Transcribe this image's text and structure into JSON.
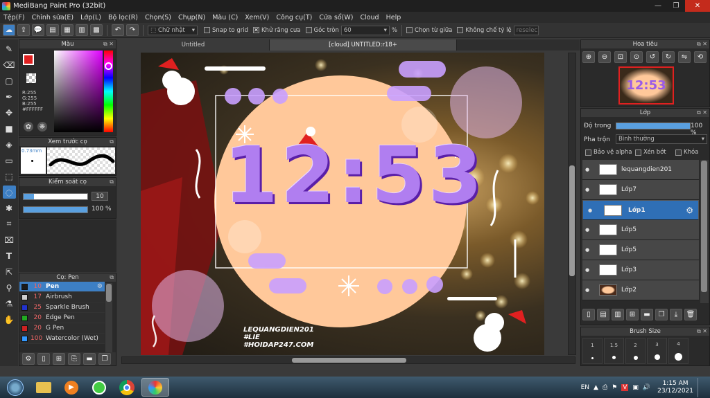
{
  "window": {
    "title": "MediBang Paint Pro (32bit)"
  },
  "menu": [
    "Tệp(F)",
    "Chỉnh sửa(E)",
    "Lớp(L)",
    "Bộ lọc(R)",
    "Chọn(S)",
    "Chụp(N)",
    "Màu (C)",
    "Xem(V)",
    "Công cụ(T)",
    "Cửa sổ(W)",
    "Cloud",
    "Help"
  ],
  "toolbar": {
    "shape": "Chữ nhật",
    "snap_to_grid": "Snap to grid",
    "antialias": "Khử răng cưa",
    "round_corner": "Góc tròn",
    "round_value": "60",
    "percent": "%",
    "center_select": "Chọn từ giữa",
    "keep_ratio": "Không chế tỷ lệ",
    "reselect": "reselec"
  },
  "color_panel": {
    "title": "Màu",
    "r": "R:255",
    "g": "G:255",
    "b": "B:255",
    "hex": "#FFFFFF",
    "fg": "#e02020",
    "bg": "#ffffff"
  },
  "brush_preview": {
    "title": "Xem trước cọ",
    "size": "0.73mm"
  },
  "brush_control": {
    "title": "Kiểm soát cọ",
    "size_value": "10",
    "opacity_value": "100 %"
  },
  "brush_list": {
    "title": "Cọ: Pen",
    "items": [
      {
        "num": "10",
        "name": "Pen",
        "color": "#1a1a1a",
        "selected": true
      },
      {
        "num": "17",
        "name": "Airbrush",
        "color": "#cfcfcf",
        "selected": false
      },
      {
        "num": "25",
        "name": "Sparkle Brush",
        "color": "#2233cc",
        "selected": false
      },
      {
        "num": "20",
        "name": "Edge Pen",
        "color": "#22aa22",
        "selected": false
      },
      {
        "num": "20",
        "name": "G Pen",
        "color": "#cc2222",
        "selected": false
      },
      {
        "num": "100",
        "name": "Watercolor (Wet)",
        "color": "#3399ff",
        "selected": false
      }
    ]
  },
  "tabs": [
    {
      "label": "Untitled",
      "active": false
    },
    {
      "label": "[cloud] UNTITLED:r18+",
      "active": true
    }
  ],
  "artwork": {
    "time": "12:53",
    "watermark": [
      "LEQUANGDIEN201",
      "#LIE",
      "#HOIDAP247.COM"
    ]
  },
  "navigator": {
    "title": "Hoa tiêu",
    "thumb_text": "12:53"
  },
  "layers_panel": {
    "title": "Lớp",
    "opacity_label": "Độ trong",
    "opacity_value": "100 %",
    "blend_label": "Pha trộn",
    "blend_value": "Bình thường",
    "protect_alpha": "Bảo vệ alpha",
    "clipping": "Xén bớt",
    "lock": "Khóa",
    "layers": [
      {
        "name": "lequangdien201",
        "selected": false
      },
      {
        "name": "Lớp7",
        "selected": false
      },
      {
        "name": "Lớp1",
        "selected": true
      },
      {
        "name": "Lớp5",
        "selected": false
      },
      {
        "name": "Lớp5",
        "selected": false
      },
      {
        "name": "Lớp3",
        "selected": false
      },
      {
        "name": "Lớp2",
        "selected": false
      }
    ]
  },
  "brush_size": {
    "title": "Brush Size",
    "sizes": [
      "1",
      "1.5",
      "2",
      "3",
      "4"
    ]
  },
  "taskbar": {
    "lang": "EN",
    "time": "1:15 AM",
    "date": "23/12/2021"
  }
}
